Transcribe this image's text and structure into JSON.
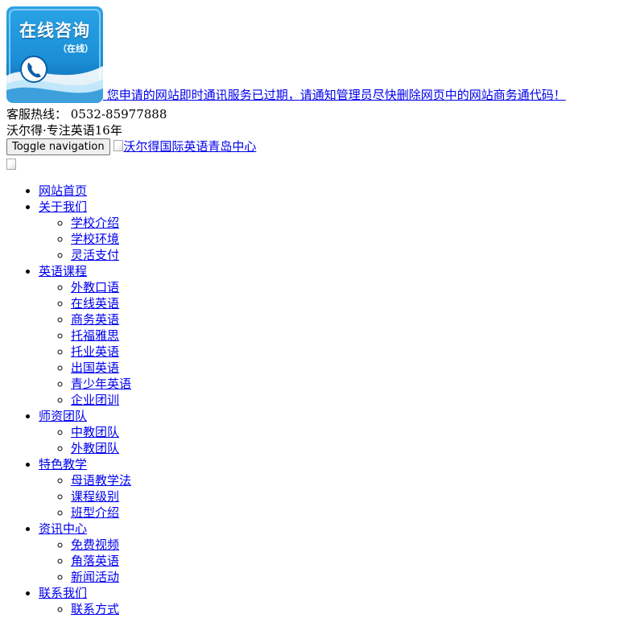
{
  "chat": {
    "logo_text": "在线咨询",
    "logo_sub": "（在线）",
    "message": "您申请的网站即时通讯服务已过期，请通知管理员尽快删除网页中的网站商务通代码！"
  },
  "hotline": {
    "label": "客服热线：",
    "number": "0532-85977888"
  },
  "slogan": "沃尔得·专注英语16年",
  "toggle_label": "Toggle navigation",
  "brand_alt": "沃尔得国际英语青岛中心",
  "nav": [
    {
      "label": "网站首页",
      "children": []
    },
    {
      "label": "关于我们",
      "children": [
        "学校介绍",
        "学校环境",
        "灵活支付"
      ]
    },
    {
      "label": "英语课程",
      "children": [
        "外教口语",
        "在线英语",
        "商务英语",
        "托福雅思",
        "托业英语",
        "出国英语",
        "青少年英语",
        "企业团训"
      ]
    },
    {
      "label": "师资团队",
      "children": [
        "中教团队",
        "外教团队"
      ]
    },
    {
      "label": "特色教学",
      "children": [
        "母语教学法",
        "课程级别",
        "班型介绍"
      ]
    },
    {
      "label": "资讯中心",
      "children": [
        "免费视频",
        "角落英语",
        "新闻活动"
      ]
    },
    {
      "label": "联系我们",
      "children": [
        "联系方式"
      ]
    }
  ],
  "colors": {
    "link": "#0000ee",
    "logo_blue": "#1b8fd6",
    "logo_dark_blue": "#0a5ea3"
  }
}
